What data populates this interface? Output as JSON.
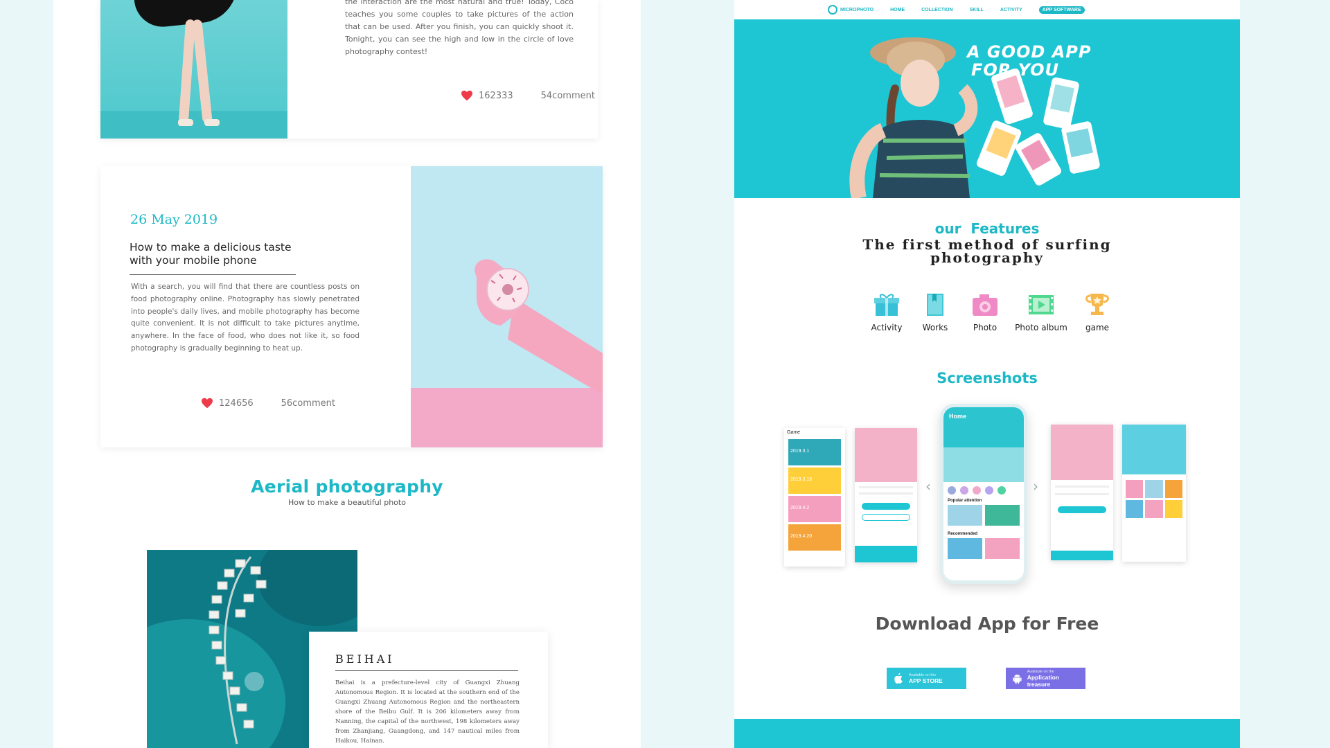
{
  "left": {
    "card1": {
      "text": "the interaction are the most natural and true! Today, Coco teaches you some couples to take pictures of the action that can be used. After you finish, you can quickly shoot it. Tonight, you can see the high and low in the circle of love photography contest!",
      "likes": "162333",
      "comments": "54comment"
    },
    "card2": {
      "date": "26 May 2019",
      "title": "How to make a delicious taste with your mobile phone",
      "body": "With a search, you will find that there are countless posts on food photography online. Photography has slowly penetrated into people's daily lives, and mobile photography has become quite convenient. It is not difficult to take pictures anytime, anywhere. In the face of food, who does not like it, so food photography is gradually beginning to heat up.",
      "likes": "124656",
      "comments": "56comment"
    },
    "section": {
      "title": "Aerial photography",
      "subtitle": "How to make a beautiful photo"
    },
    "beihai": {
      "heading": "BEIHAI",
      "body": "Beihai is a prefecture-level city of Guangxi Zhuang Autonomous Region. It is located at the southern end of the Guangxi Zhuang Autonomous Region and the northeastern shore of the Beibu Gulf. It is 206 kilometers away from Nanning, the capital of the northwest, 198 kilometers away from Zhanjiang, Guangdong, and 147 nautical miles from Haikou, Hainan."
    }
  },
  "right": {
    "nav": {
      "logo": "MICROPHOTO",
      "items": [
        "HOME",
        "COLLECTION",
        "SKILL",
        "ACTIVITY",
        "APP SOFTWARE"
      ]
    },
    "hero": {
      "tagline_line1": "A GOOD APP",
      "tagline_line2": "FOR YOU"
    },
    "features": {
      "heading": "our  Features",
      "subheading": "The first method of surfing photography",
      "items": [
        {
          "label": "Activity",
          "icon": "gift-icon",
          "color": "#38c0d6"
        },
        {
          "label": "Works",
          "icon": "bookmark-book-icon",
          "color": "#3ec8d6"
        },
        {
          "label": "Photo",
          "icon": "camera-icon",
          "color": "#f08ac6"
        },
        {
          "label": "Photo album",
          "icon": "film-strip-icon",
          "color": "#4fd88e"
        },
        {
          "label": "game",
          "icon": "trophy-icon",
          "color": "#f6b84a"
        }
      ]
    },
    "screenshots": {
      "title": "Screenshots",
      "phone_header": "Home",
      "left_screen_header": "Game",
      "game_tiles": [
        "2019.3.1",
        "2019.3.15",
        "2019.4.2",
        "2019.4.20"
      ],
      "popular": "Popular attention",
      "recommended": "Recommended"
    },
    "download": {
      "title": "Download App for Free",
      "app_store_small": "Available on the",
      "app_store_big": "APP STORE",
      "android_small": "Available on the",
      "android_big": "Application treasure"
    },
    "colors": {
      "accent": "#1cb8c6",
      "hero_bg": "#1ec6d3",
      "app_store_btn": "#2cc4d8",
      "android_btn": "#7b6fe6"
    }
  }
}
